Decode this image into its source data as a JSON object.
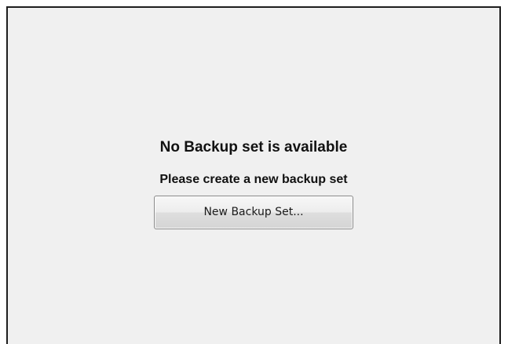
{
  "empty_state": {
    "title": "No Backup set is available",
    "message": "Please create a new backup set",
    "new_backup_button_label": "New Backup Set..."
  }
}
